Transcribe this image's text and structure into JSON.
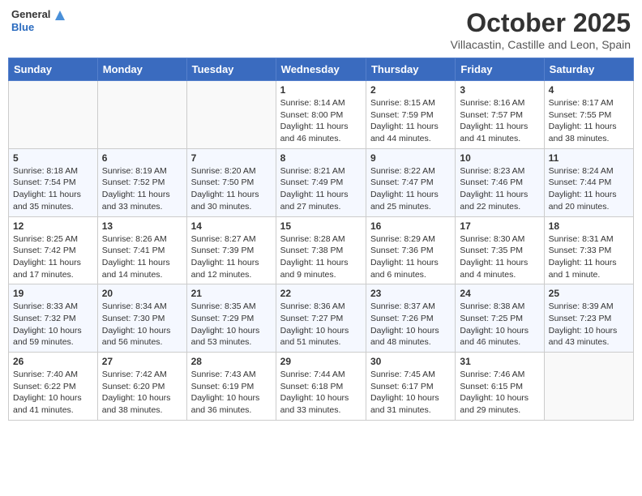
{
  "header": {
    "logo_general": "General",
    "logo_blue": "Blue",
    "title": "October 2025",
    "subtitle": "Villacastin, Castille and Leon, Spain"
  },
  "weekdays": [
    "Sunday",
    "Monday",
    "Tuesday",
    "Wednesday",
    "Thursday",
    "Friday",
    "Saturday"
  ],
  "weeks": [
    [
      {
        "day": "",
        "info": ""
      },
      {
        "day": "",
        "info": ""
      },
      {
        "day": "",
        "info": ""
      },
      {
        "day": "1",
        "info": "Sunrise: 8:14 AM\nSunset: 8:00 PM\nDaylight: 11 hours and 46 minutes."
      },
      {
        "day": "2",
        "info": "Sunrise: 8:15 AM\nSunset: 7:59 PM\nDaylight: 11 hours and 44 minutes."
      },
      {
        "day": "3",
        "info": "Sunrise: 8:16 AM\nSunset: 7:57 PM\nDaylight: 11 hours and 41 minutes."
      },
      {
        "day": "4",
        "info": "Sunrise: 8:17 AM\nSunset: 7:55 PM\nDaylight: 11 hours and 38 minutes."
      }
    ],
    [
      {
        "day": "5",
        "info": "Sunrise: 8:18 AM\nSunset: 7:54 PM\nDaylight: 11 hours and 35 minutes."
      },
      {
        "day": "6",
        "info": "Sunrise: 8:19 AM\nSunset: 7:52 PM\nDaylight: 11 hours and 33 minutes."
      },
      {
        "day": "7",
        "info": "Sunrise: 8:20 AM\nSunset: 7:50 PM\nDaylight: 11 hours and 30 minutes."
      },
      {
        "day": "8",
        "info": "Sunrise: 8:21 AM\nSunset: 7:49 PM\nDaylight: 11 hours and 27 minutes."
      },
      {
        "day": "9",
        "info": "Sunrise: 8:22 AM\nSunset: 7:47 PM\nDaylight: 11 hours and 25 minutes."
      },
      {
        "day": "10",
        "info": "Sunrise: 8:23 AM\nSunset: 7:46 PM\nDaylight: 11 hours and 22 minutes."
      },
      {
        "day": "11",
        "info": "Sunrise: 8:24 AM\nSunset: 7:44 PM\nDaylight: 11 hours and 20 minutes."
      }
    ],
    [
      {
        "day": "12",
        "info": "Sunrise: 8:25 AM\nSunset: 7:42 PM\nDaylight: 11 hours and 17 minutes."
      },
      {
        "day": "13",
        "info": "Sunrise: 8:26 AM\nSunset: 7:41 PM\nDaylight: 11 hours and 14 minutes."
      },
      {
        "day": "14",
        "info": "Sunrise: 8:27 AM\nSunset: 7:39 PM\nDaylight: 11 hours and 12 minutes."
      },
      {
        "day": "15",
        "info": "Sunrise: 8:28 AM\nSunset: 7:38 PM\nDaylight: 11 hours and 9 minutes."
      },
      {
        "day": "16",
        "info": "Sunrise: 8:29 AM\nSunset: 7:36 PM\nDaylight: 11 hours and 6 minutes."
      },
      {
        "day": "17",
        "info": "Sunrise: 8:30 AM\nSunset: 7:35 PM\nDaylight: 11 hours and 4 minutes."
      },
      {
        "day": "18",
        "info": "Sunrise: 8:31 AM\nSunset: 7:33 PM\nDaylight: 11 hours and 1 minute."
      }
    ],
    [
      {
        "day": "19",
        "info": "Sunrise: 8:33 AM\nSunset: 7:32 PM\nDaylight: 10 hours and 59 minutes."
      },
      {
        "day": "20",
        "info": "Sunrise: 8:34 AM\nSunset: 7:30 PM\nDaylight: 10 hours and 56 minutes."
      },
      {
        "day": "21",
        "info": "Sunrise: 8:35 AM\nSunset: 7:29 PM\nDaylight: 10 hours and 53 minutes."
      },
      {
        "day": "22",
        "info": "Sunrise: 8:36 AM\nSunset: 7:27 PM\nDaylight: 10 hours and 51 minutes."
      },
      {
        "day": "23",
        "info": "Sunrise: 8:37 AM\nSunset: 7:26 PM\nDaylight: 10 hours and 48 minutes."
      },
      {
        "day": "24",
        "info": "Sunrise: 8:38 AM\nSunset: 7:25 PM\nDaylight: 10 hours and 46 minutes."
      },
      {
        "day": "25",
        "info": "Sunrise: 8:39 AM\nSunset: 7:23 PM\nDaylight: 10 hours and 43 minutes."
      }
    ],
    [
      {
        "day": "26",
        "info": "Sunrise: 7:40 AM\nSunset: 6:22 PM\nDaylight: 10 hours and 41 minutes."
      },
      {
        "day": "27",
        "info": "Sunrise: 7:42 AM\nSunset: 6:20 PM\nDaylight: 10 hours and 38 minutes."
      },
      {
        "day": "28",
        "info": "Sunrise: 7:43 AM\nSunset: 6:19 PM\nDaylight: 10 hours and 36 minutes."
      },
      {
        "day": "29",
        "info": "Sunrise: 7:44 AM\nSunset: 6:18 PM\nDaylight: 10 hours and 33 minutes."
      },
      {
        "day": "30",
        "info": "Sunrise: 7:45 AM\nSunset: 6:17 PM\nDaylight: 10 hours and 31 minutes."
      },
      {
        "day": "31",
        "info": "Sunrise: 7:46 AM\nSunset: 6:15 PM\nDaylight: 10 hours and 29 minutes."
      },
      {
        "day": "",
        "info": ""
      }
    ]
  ]
}
